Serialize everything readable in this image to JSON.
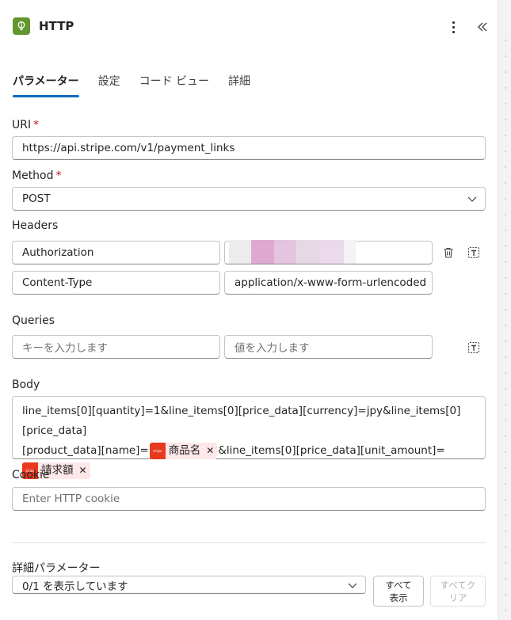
{
  "header": {
    "title": "HTTP",
    "accent": "#62962f"
  },
  "tabs": [
    {
      "label": "パラメーター",
      "active": true
    },
    {
      "label": "設定"
    },
    {
      "label": "コード ビュー"
    },
    {
      "label": "詳細"
    }
  ],
  "uri": {
    "label": "URI",
    "required": "*",
    "value": "https://api.stripe.com/v1/payment_links"
  },
  "method": {
    "label": "Method",
    "required": "*",
    "value": "POST"
  },
  "headers": {
    "label": "Headers",
    "rows": [
      {
        "key": "Authorization",
        "value": ""
      },
      {
        "key": "Content-Type",
        "value": "application/x-www-form-urlencoded"
      }
    ]
  },
  "queries": {
    "label": "Queries",
    "key_placeholder": "キーを入力します",
    "value_placeholder": "値を入力します"
  },
  "body": {
    "label": "Body",
    "line1": "line_items[0][quantity]=1&line_items[0][price_data][currency]=jpy&line_items[0][price_data]",
    "part2": "[product_data][name]=",
    "token1": "商品名",
    "part3": "&line_items[0][price_data][unit_amount]=",
    "token2": "請求額"
  },
  "cookie": {
    "label": "Cookie",
    "placeholder": "Enter HTTP cookie"
  },
  "advanced": {
    "label": "詳細パラメーター",
    "select_value": "0/1 を表示しています",
    "show_all_line1": "すべて",
    "show_all_line2": "表示",
    "clear_all_line1": "すべてク",
    "clear_all_line2": "リア"
  },
  "colors": {
    "tab_underline": "#0f6cbd",
    "required": "#c50f1f",
    "token_bg": "#fde7e9",
    "token_logo": "#e8391f"
  }
}
